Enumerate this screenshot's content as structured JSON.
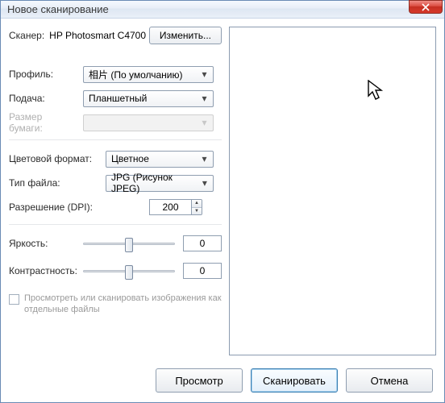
{
  "window": {
    "title": "Новое сканирование"
  },
  "scanner": {
    "label": "Сканер:",
    "name": "HP Photosmart C4700",
    "change_btn": "Изменить..."
  },
  "profile": {
    "label": "Профиль:",
    "value": "相片 (По умолчанию)"
  },
  "source": {
    "label": "Подача:",
    "value": "Планшетный"
  },
  "paper_size": {
    "label": "Размер бумаги:",
    "value": ""
  },
  "color_format": {
    "label": "Цветовой формат:",
    "value": "Цветное"
  },
  "file_type": {
    "label": "Тип файла:",
    "value": "JPG (Рисунок JPEG)"
  },
  "resolution": {
    "label": "Разрешение (DPI):",
    "value": "200"
  },
  "brightness": {
    "label": "Яркость:",
    "value": "0"
  },
  "contrast": {
    "label": "Контрастность:",
    "value": "0"
  },
  "multipage": {
    "label": "Просмотреть или сканировать изображения как отдельные файлы"
  },
  "buttons": {
    "preview": "Просмотр",
    "scan": "Сканировать",
    "cancel": "Отмена"
  }
}
